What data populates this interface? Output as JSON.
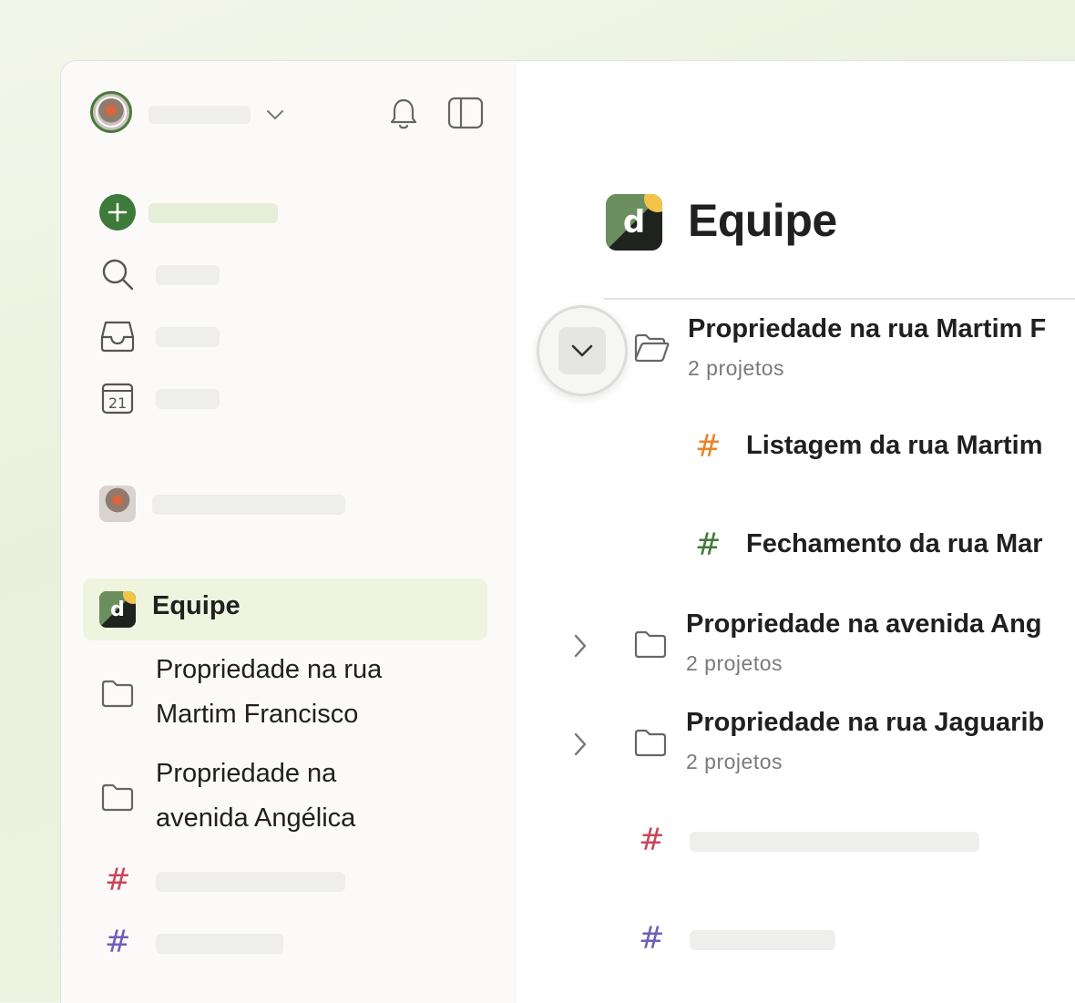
{
  "sidebar": {
    "team": {
      "label": "Equipe",
      "logo_letter": "d"
    },
    "folders": [
      {
        "label": "Propriedade na rua Martim Francisco"
      },
      {
        "label": "Propriedade na avenida Angélica"
      }
    ],
    "project_hash_colors": [
      "#c8485b",
      "#6f5fb8"
    ]
  },
  "main": {
    "title": "Equipe",
    "logo_letter": "d",
    "items": [
      {
        "title": "Propriedade na rua Martim F",
        "subtitle": "2 projetos",
        "expanded": true
      },
      {
        "title": "Listagem da rua Martim",
        "hash_color": "#e8832a"
      },
      {
        "title": "Fechamento da rua Mar",
        "hash_color": "#3f7a3a"
      },
      {
        "title": "Propriedade na avenida Ang",
        "subtitle": "2 projetos",
        "expanded": false
      },
      {
        "title": "Propriedade na rua Jaguarib",
        "subtitle": "2 projetos",
        "expanded": false
      }
    ],
    "extra_hash_colors": [
      "#c8485b",
      "#6f5fb8"
    ]
  },
  "colors": {
    "accent_green": "#3f7a3a",
    "selected_bg": "#eef4de",
    "placeholder": "#eeeeec"
  }
}
